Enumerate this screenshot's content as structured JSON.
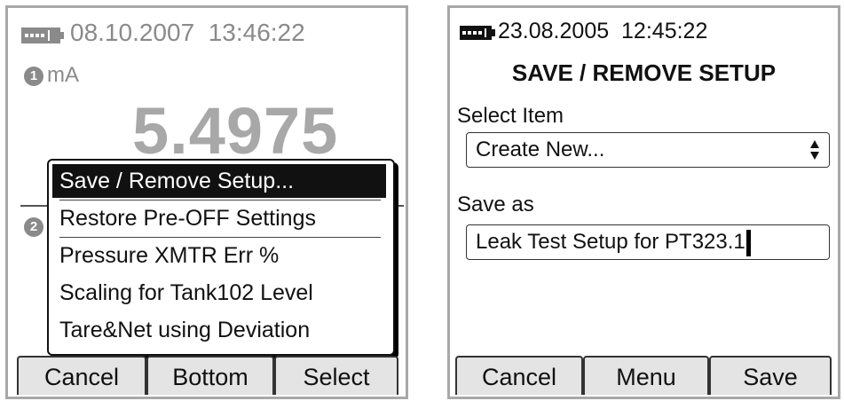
{
  "left": {
    "status": {
      "date": "08.10.2007",
      "time": "13:46:22",
      "icon": "battery-icon"
    },
    "channel1": {
      "badge": "1",
      "unit": "mA",
      "reading": "5.4975"
    },
    "channel2": {
      "badge": "2"
    },
    "menu": {
      "items": [
        "Save / Remove Setup...",
        "Restore Pre-OFF Settings",
        "Pressure XMTR Err %",
        "Scaling for Tank102 Level",
        "Tare&Net using Deviation"
      ],
      "selected_index": 0
    },
    "softkeys": {
      "left": "Cancel",
      "middle": "Bottom",
      "right": "Select"
    }
  },
  "right": {
    "status": {
      "date": "23.08.2005",
      "time": "12:45:22",
      "icon": "battery-icon"
    },
    "title": "SAVE / REMOVE SETUP",
    "select_item": {
      "label": "Select Item",
      "value": "Create New...",
      "icon": "up-down-spinner-icon"
    },
    "save_as": {
      "label": "Save as",
      "value": "Leak Test Setup for PT323.1"
    },
    "softkeys": {
      "left": "Cancel",
      "middle": "Menu",
      "right": "Save"
    }
  }
}
